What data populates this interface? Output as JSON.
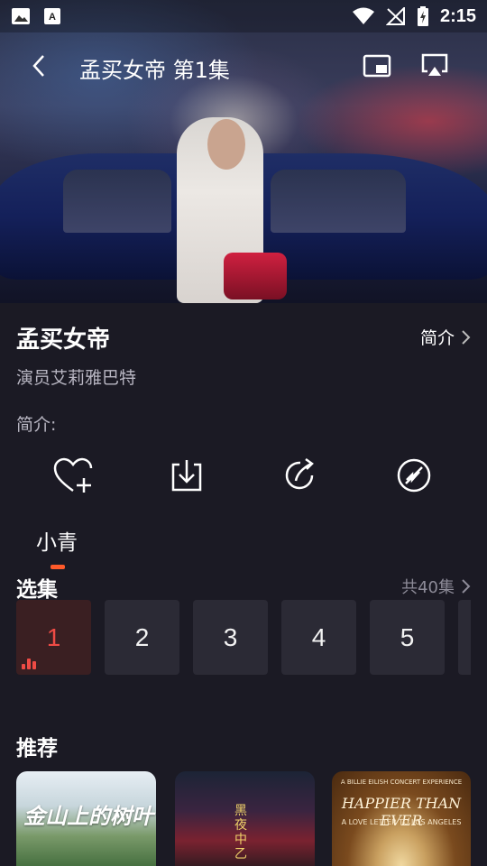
{
  "status_bar": {
    "time": "2:15",
    "icons": [
      "image-icon",
      "text-icon",
      "wifi-icon",
      "no-signal-icon",
      "battery-charging-icon"
    ]
  },
  "player": {
    "title": "孟买女帝 第1集",
    "icons": [
      "back-icon",
      "picture-in-picture-icon",
      "airplay-icon"
    ]
  },
  "show": {
    "title": "孟买女帝",
    "intro_link": "简介",
    "cast": "演员艾莉雅巴特",
    "intro_label": "简介:"
  },
  "actions": [
    "favorite-add-icon",
    "download-icon",
    "share-icon",
    "skip-icon"
  ],
  "tabs": {
    "active": "小青"
  },
  "episodes": {
    "title": "选集",
    "count": "共40集",
    "items": [
      "1",
      "2",
      "3",
      "4",
      "5"
    ],
    "active_index": 0
  },
  "recommend": {
    "title": "推荐",
    "items": [
      {
        "overlay_text": "金山上的树叶"
      },
      {
        "overlay_text": "黑夜中乙"
      },
      {
        "overlay_small": "A BILLIE EILISH CONCERT EXPERIENCE",
        "overlay_big": "HAPPIER THAN EVER",
        "overlay_sub": "A LOVE LETTER TO LOS ANGELES"
      }
    ]
  },
  "colors": {
    "accent": "#ef4b45",
    "tab_indicator": "#ff5a2a",
    "background": "#1b1a24"
  }
}
